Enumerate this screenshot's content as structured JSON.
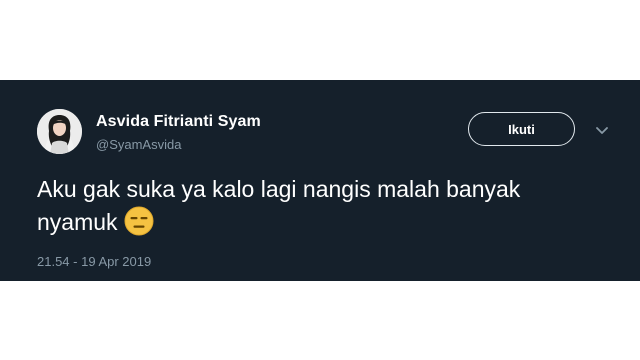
{
  "tweet": {
    "author": {
      "display_name": "Asvida Fitrianti Syam",
      "handle": "@SyamAsvida"
    },
    "follow_label": "Ikuti",
    "text": "Aku gak suka ya kalo lagi nangis malah banyak nyamuk",
    "emoji": "expressionless-face-emoji",
    "timestamp": "21.54 - 19 Apr 2019",
    "more_icon": "chevron-down-icon"
  },
  "colors": {
    "card_background": "#15202b",
    "secondary_text": "#8899a6",
    "primary_text": "#ffffff",
    "button_border": "#e1e8ed",
    "emoji_fill": "#f5c242"
  }
}
